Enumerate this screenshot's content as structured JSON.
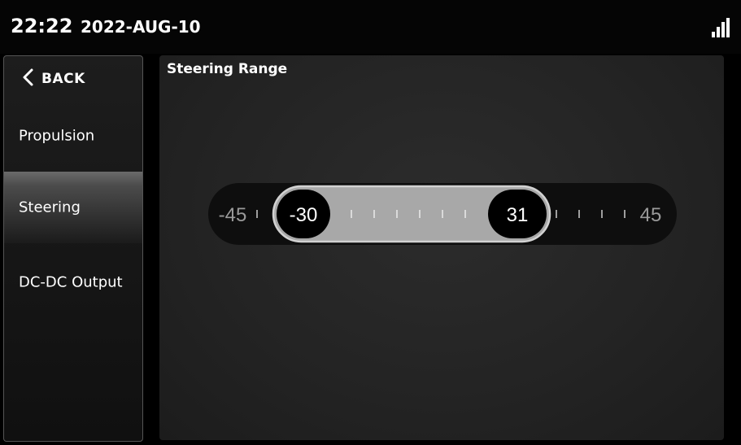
{
  "statusbar": {
    "time": "22:22",
    "date": "2022-AUG-10",
    "signal_icon": "signal-strength-icon"
  },
  "sidebar": {
    "back_label": "BACK",
    "items": [
      {
        "label": "Propulsion",
        "active": false
      },
      {
        "label": "Steering",
        "active": true
      },
      {
        "label": "DC-DC Output",
        "active": false
      }
    ]
  },
  "main": {
    "title": "Steering Range",
    "range": {
      "min_label": "-45",
      "max_label": "45",
      "low_value": "-30",
      "high_value": "31"
    }
  },
  "colors": {
    "accent_fill": "#a8a8a8",
    "text": "#ffffff",
    "muted_text": "#9a9a9a"
  }
}
